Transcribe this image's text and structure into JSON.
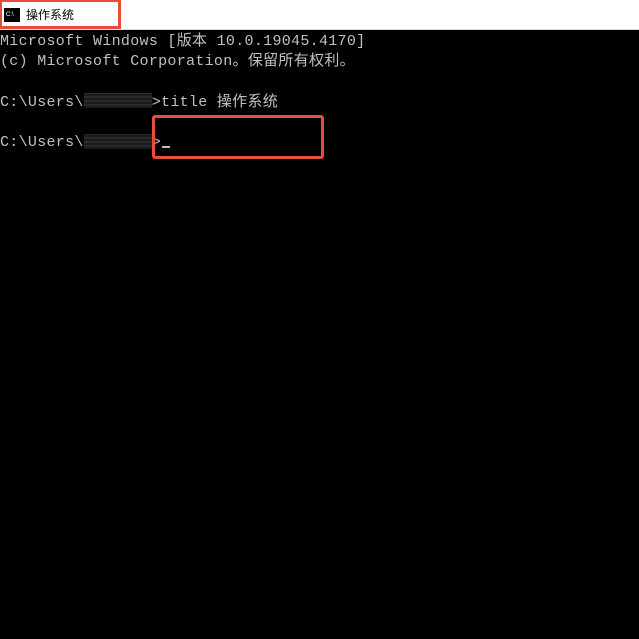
{
  "titlebar": {
    "title": "操作系统"
  },
  "terminal": {
    "line1": "Microsoft Windows [版本 10.0.19045.4170]",
    "line2": "(c) Microsoft Corporation。保留所有权利。",
    "prompt1_prefix": "C:\\Users\\",
    "prompt1_suffix": ">",
    "command1": "title 操作系统",
    "prompt2_prefix": "C:\\Users\\",
    "prompt2_suffix": ">"
  }
}
